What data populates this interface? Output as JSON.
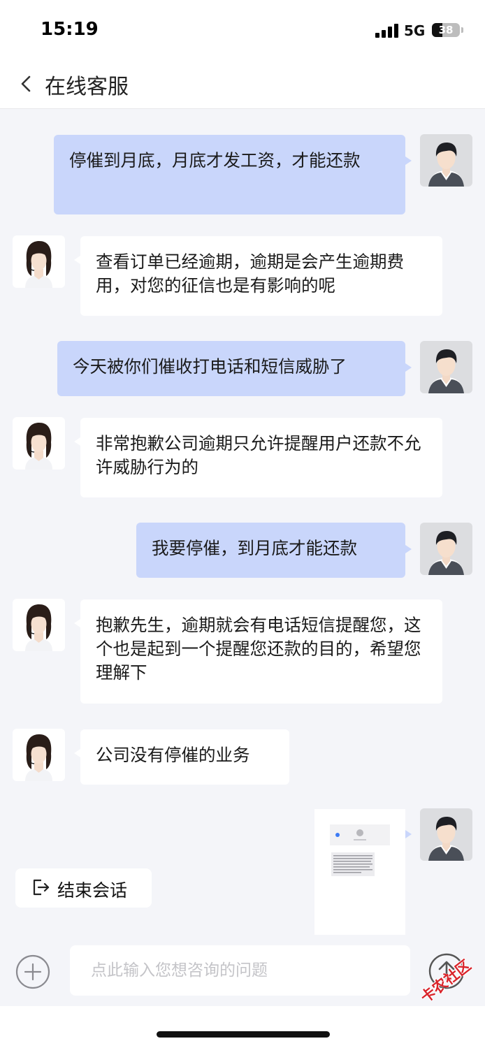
{
  "status_bar": {
    "time": "15:19",
    "network": "5G",
    "battery": "38"
  },
  "header": {
    "title": "在线客服"
  },
  "messages": [
    {
      "from": "user",
      "text": "停催到月底，月底才发工资，才能还款"
    },
    {
      "from": "agent",
      "text": "查看订单已经逾期，逾期是会产生逾期费用，对您的征信也是有影响的呢"
    },
    {
      "from": "user",
      "text": "今天被你们催收打电话和短信威胁了"
    },
    {
      "from": "agent",
      "text": "非常抱歉公司逾期只允许提醒用户还款不允许威胁行为的"
    },
    {
      "from": "user",
      "text": "我要停催，到月底才能还款"
    },
    {
      "from": "agent",
      "text": "抱歉先生，逾期就会有电话短信提醒您，这个也是起到一个提醒您还款的目的，希望您理解下"
    },
    {
      "from": "agent",
      "text": "公司没有停催的业务"
    },
    {
      "from": "user",
      "type": "image",
      "description": "screenshot"
    }
  ],
  "end_session": {
    "label": "结束会话"
  },
  "input": {
    "placeholder": "点此输入您想咨询的问题"
  },
  "watermark": "卡农社区",
  "colors": {
    "user_bubble": "#c9d6fb",
    "agent_bubble": "#ffffff",
    "background": "#f4f5f9",
    "watermark": "#d9242b"
  }
}
